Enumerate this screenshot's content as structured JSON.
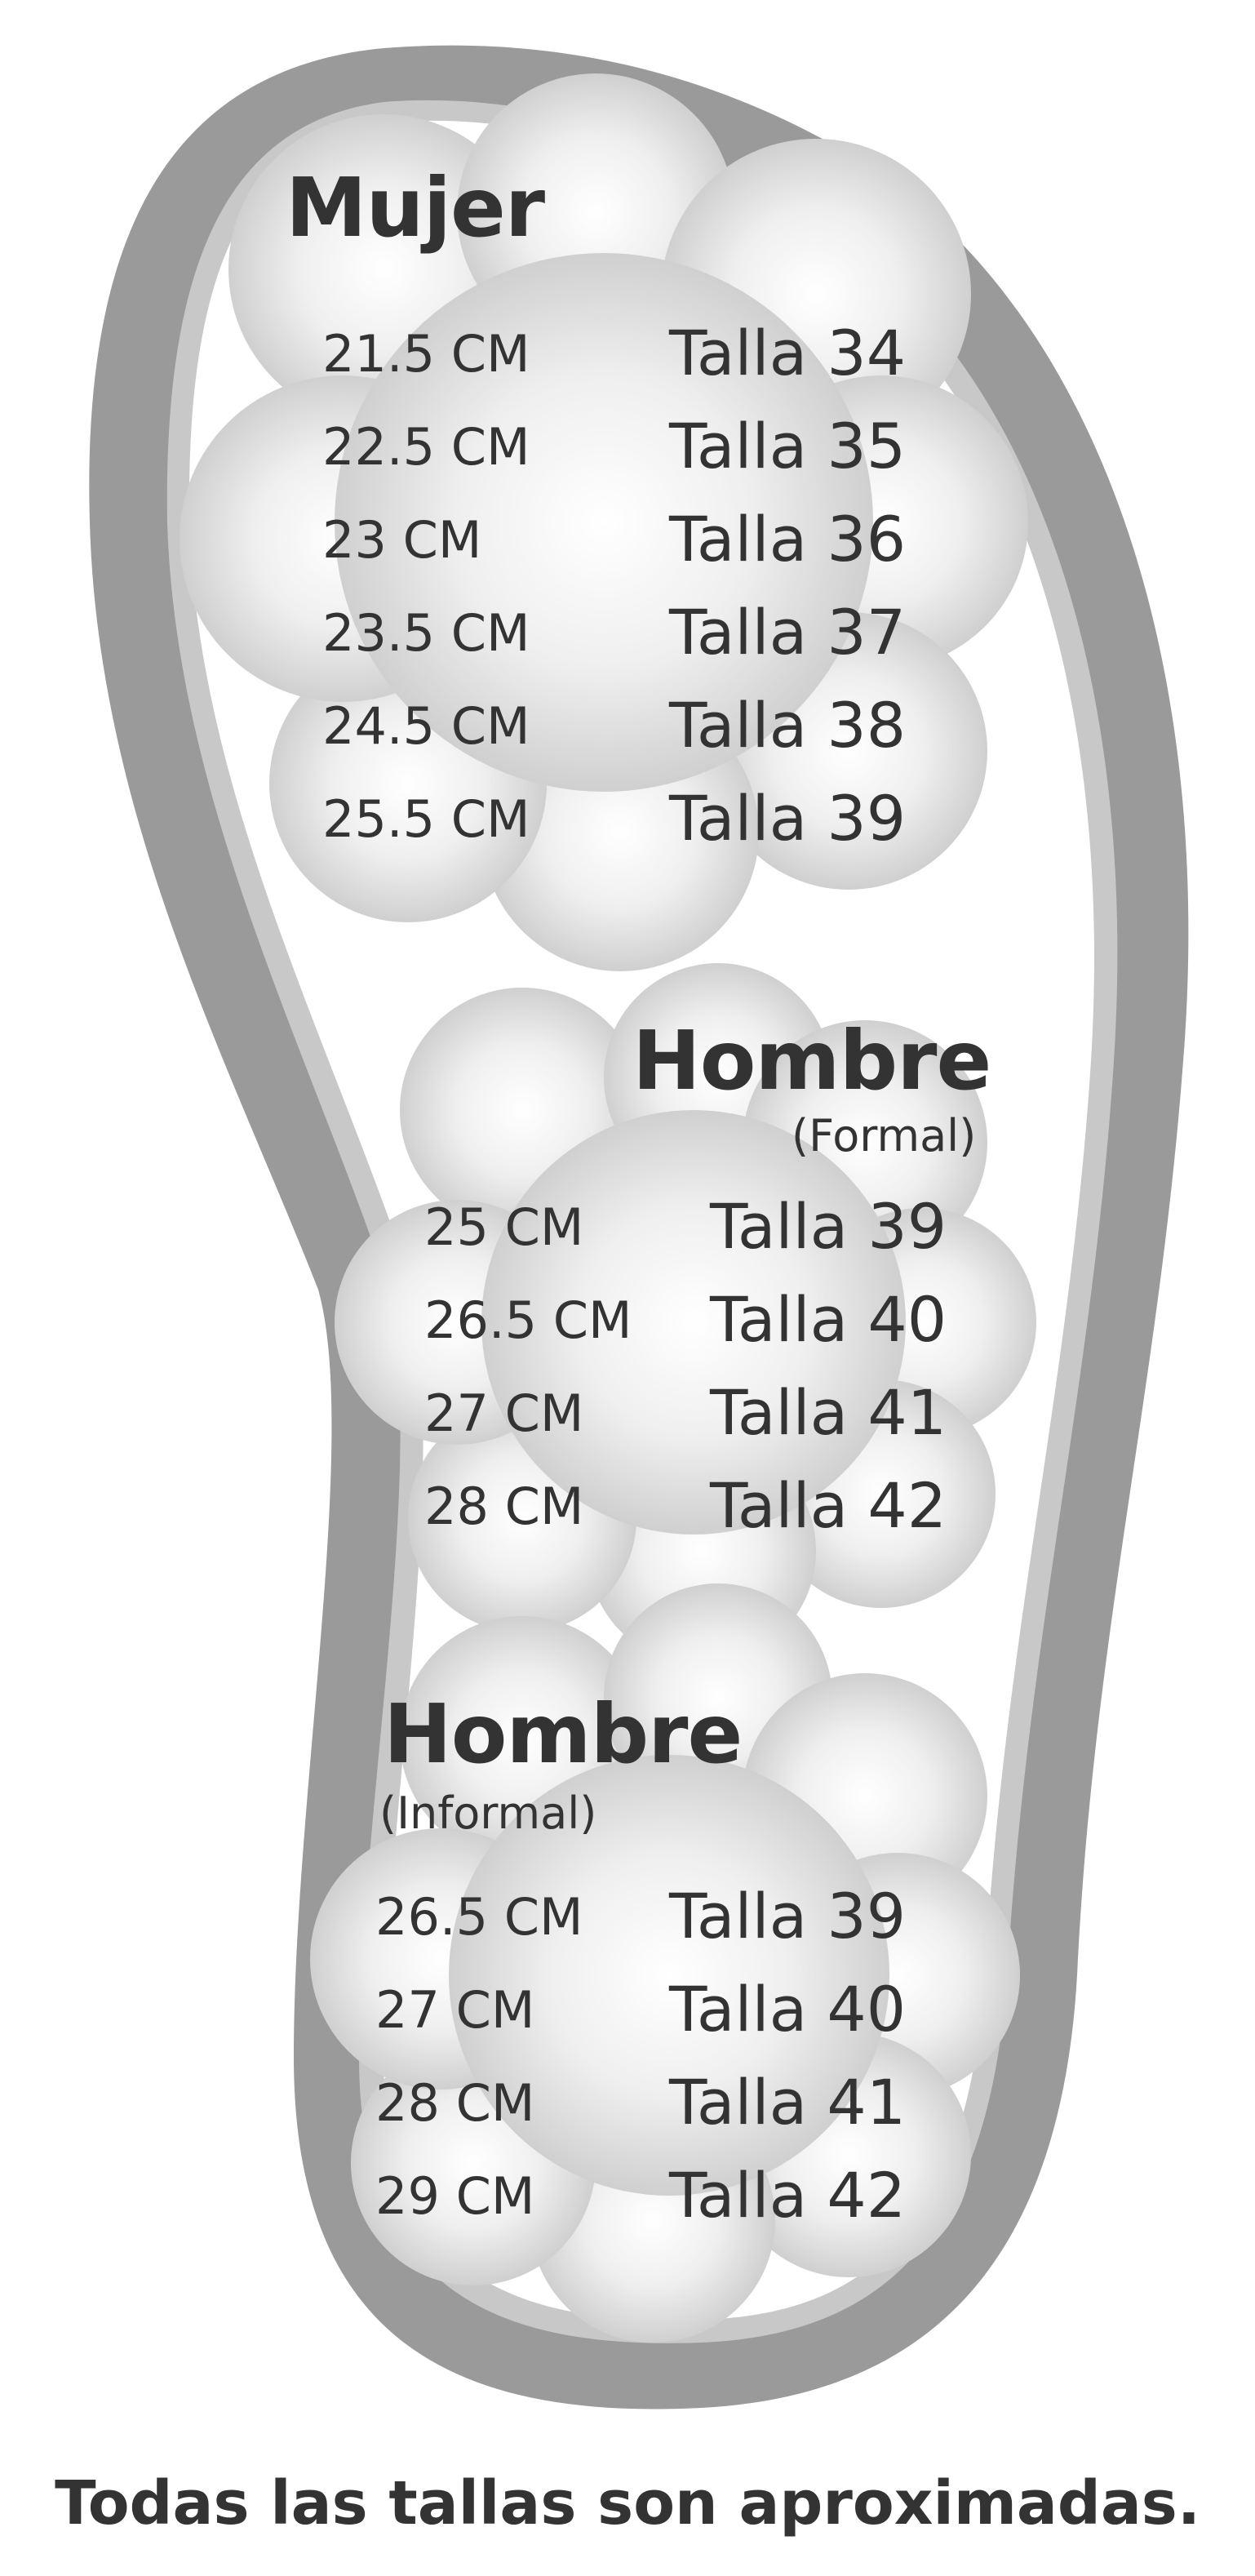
{
  "colors": {
    "sole_outer": "#9a9a9a",
    "sole_inner_border": "#c8c8c8",
    "insole": "#ffffff",
    "cloud_light": "#f4f4f4",
    "cloud_dark": "#c4c4c4",
    "text": "#333333"
  },
  "mujer": {
    "title": "Mujer",
    "rows": [
      {
        "cm": "21.5 CM",
        "talla": "Talla 34"
      },
      {
        "cm": "22.5 CM",
        "talla": "Talla 35"
      },
      {
        "cm": "23  CM",
        "talla": "Talla 36"
      },
      {
        "cm": "23.5 CM",
        "talla": "Talla 37"
      },
      {
        "cm": "24.5 CM",
        "talla": "Talla 38"
      },
      {
        "cm": "25.5 CM",
        "talla": "Talla 39"
      }
    ]
  },
  "hombre_formal": {
    "title": "Hombre",
    "subtitle": "(Formal)",
    "rows": [
      {
        "cm": "25  CM",
        "talla": "Talla 39"
      },
      {
        "cm": "26.5 CM",
        "talla": "Talla 40"
      },
      {
        "cm": "27  CM",
        "talla": "Talla 41"
      },
      {
        "cm": "28  CM",
        "talla": "Talla 42"
      }
    ]
  },
  "hombre_informal": {
    "title": "Hombre",
    "subtitle": "(Informal)",
    "rows": [
      {
        "cm": "26.5 CM",
        "talla": "Talla 39"
      },
      {
        "cm": "27  CM",
        "talla": "Talla 40"
      },
      {
        "cm": "28  CM",
        "talla": "Talla 41"
      },
      {
        "cm": "29  CM",
        "talla": "Talla 42"
      }
    ]
  },
  "footnote": "Todas las tallas son aproximadas."
}
